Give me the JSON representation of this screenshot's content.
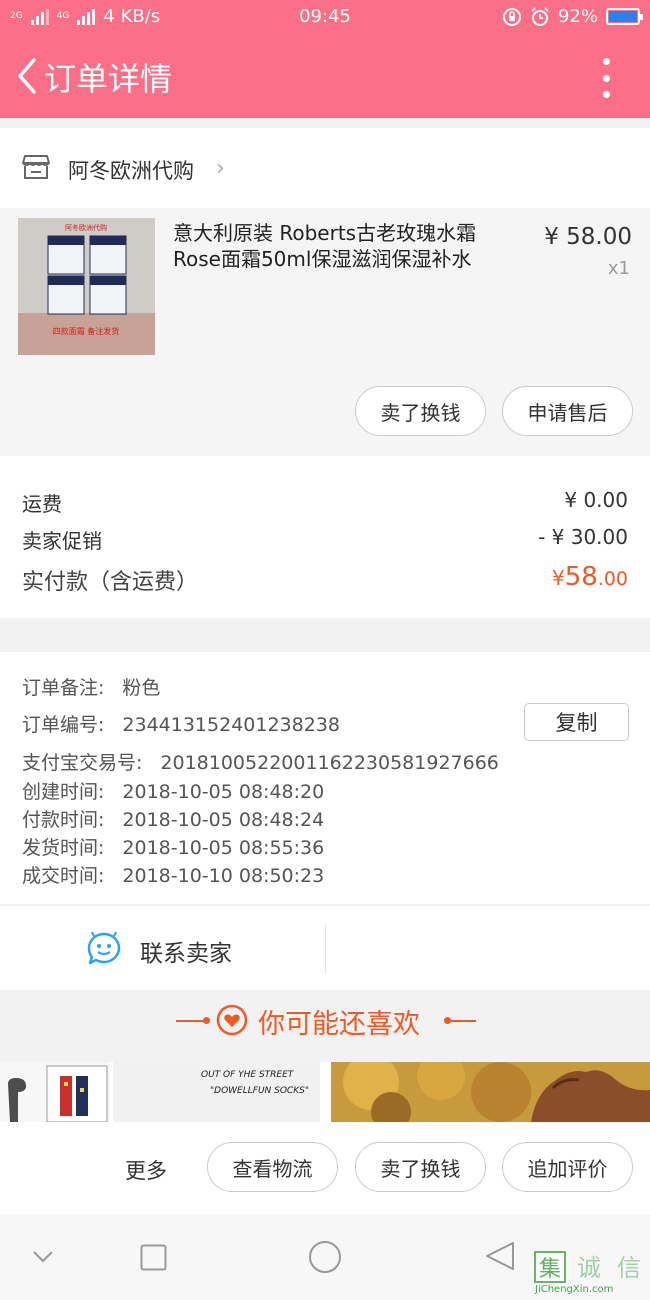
{
  "status_bar": {
    "network_speed": "4 KB/s",
    "signal_1": "2G",
    "signal_2": "4G",
    "time": "09:45",
    "battery": "92%",
    "battery_level": 0.92
  },
  "header": {
    "title": "订单详情"
  },
  "store": {
    "name": "阿冬欧洲代购"
  },
  "product": {
    "title": "意大利原装 Roberts古老玫瑰水霜Rose面霜50ml保湿滋润保湿补水",
    "price": "¥ 58.00",
    "qty": "x1",
    "image_caption_top": "阿冬欧洲代购",
    "image_caption_bottom": "四款面霜 备注发货",
    "buttons": [
      "卖了换钱",
      "申请售后"
    ]
  },
  "totals": {
    "shipping_label": "运费",
    "shipping_value": "¥ 0.00",
    "promo_label": "卖家促销",
    "promo_value": "- ¥ 30.00",
    "paid_label": "实付款（含运费）",
    "paid_currency": "¥",
    "paid_int": "58",
    "paid_dec": ".00"
  },
  "info": {
    "remark_label": "订单备注:",
    "remark_value": "粉色",
    "order_no_label": "订单编号:",
    "order_no_value": "234413152401238238",
    "copy_label": "复制",
    "alipay_label": "支付宝交易号:",
    "alipay_value": "2018100522001162230581927666",
    "created_label": "创建时间:",
    "created_value": "2018-10-05 08:48:20",
    "paid_time_label": "付款时间:",
    "paid_time_value": "2018-10-05 08:48:24",
    "shipped_label": "发货时间:",
    "shipped_value": "2018-10-05 08:55:36",
    "closed_label": "成交时间:",
    "closed_value": "2018-10-10 08:50:23"
  },
  "contact": {
    "label": "联系卖家"
  },
  "recommend": {
    "title": "你可能还喜欢",
    "card2_line1": "OUT OF YHE STREET",
    "card2_line2": "\"DOWELLFUN  SOCKS\""
  },
  "actions": {
    "more": "更多",
    "logistics": "查看物流",
    "resell": "卖了换钱",
    "review": "追加评价"
  },
  "watermark": {
    "text": "JiChengXin.com",
    "logo": "集诚信"
  },
  "colors": {
    "brand": "#fc6f86",
    "accent_orange": "#ef5a22",
    "contact_blue": "#2aa3e9"
  }
}
